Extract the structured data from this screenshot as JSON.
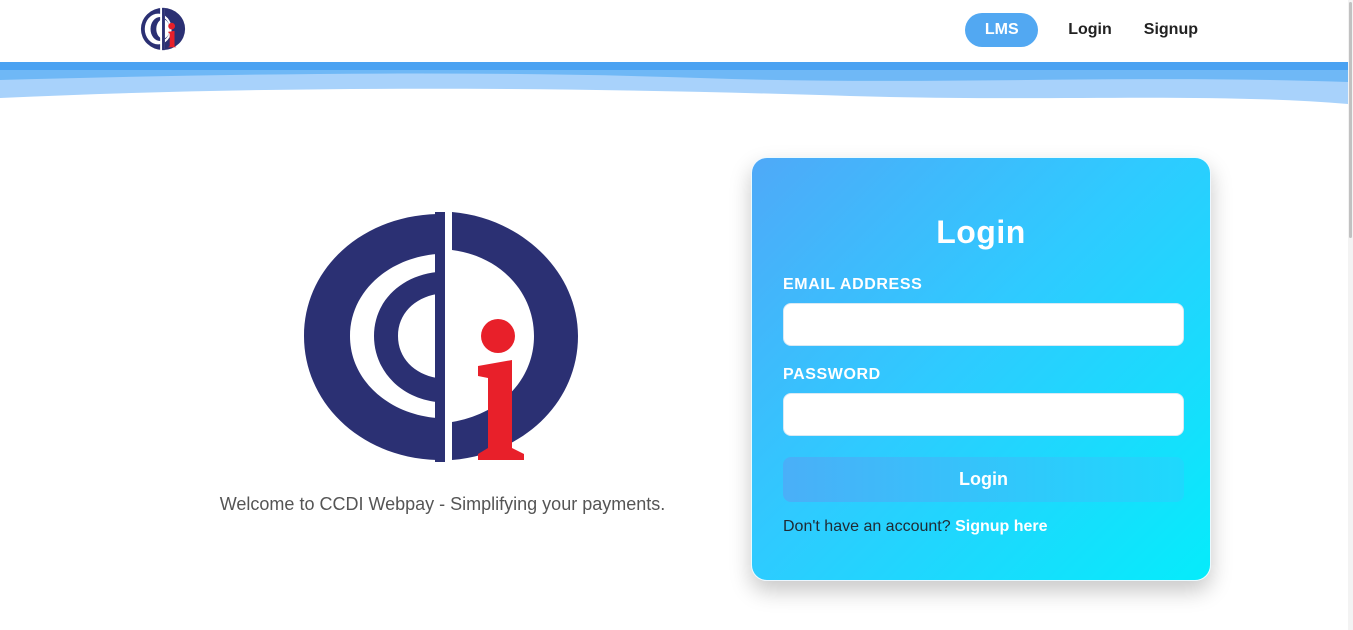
{
  "header": {
    "nav": {
      "lms": "LMS",
      "login": "Login",
      "signup": "Signup"
    }
  },
  "hero": {
    "welcome_text": "Welcome to CCDI Webpay - Simplifying your payments."
  },
  "login_card": {
    "title": "Login",
    "email_label": "EMAIL ADDRESS",
    "email_value": "",
    "password_label": "PASSWORD",
    "password_value": "",
    "submit_label": "Login",
    "signup_prompt": "Don't have an account?",
    "signup_link": "Signup here"
  },
  "colors": {
    "brand_navy": "#2b3073",
    "brand_red": "#e8202a",
    "accent_blue": "#52a8f2",
    "card_gradient_start": "#4fa9f8",
    "card_gradient_end": "#05ecfb"
  },
  "icons": {
    "logo": "ccdi-logo",
    "hero_logo": "ccdi-logo-large"
  }
}
